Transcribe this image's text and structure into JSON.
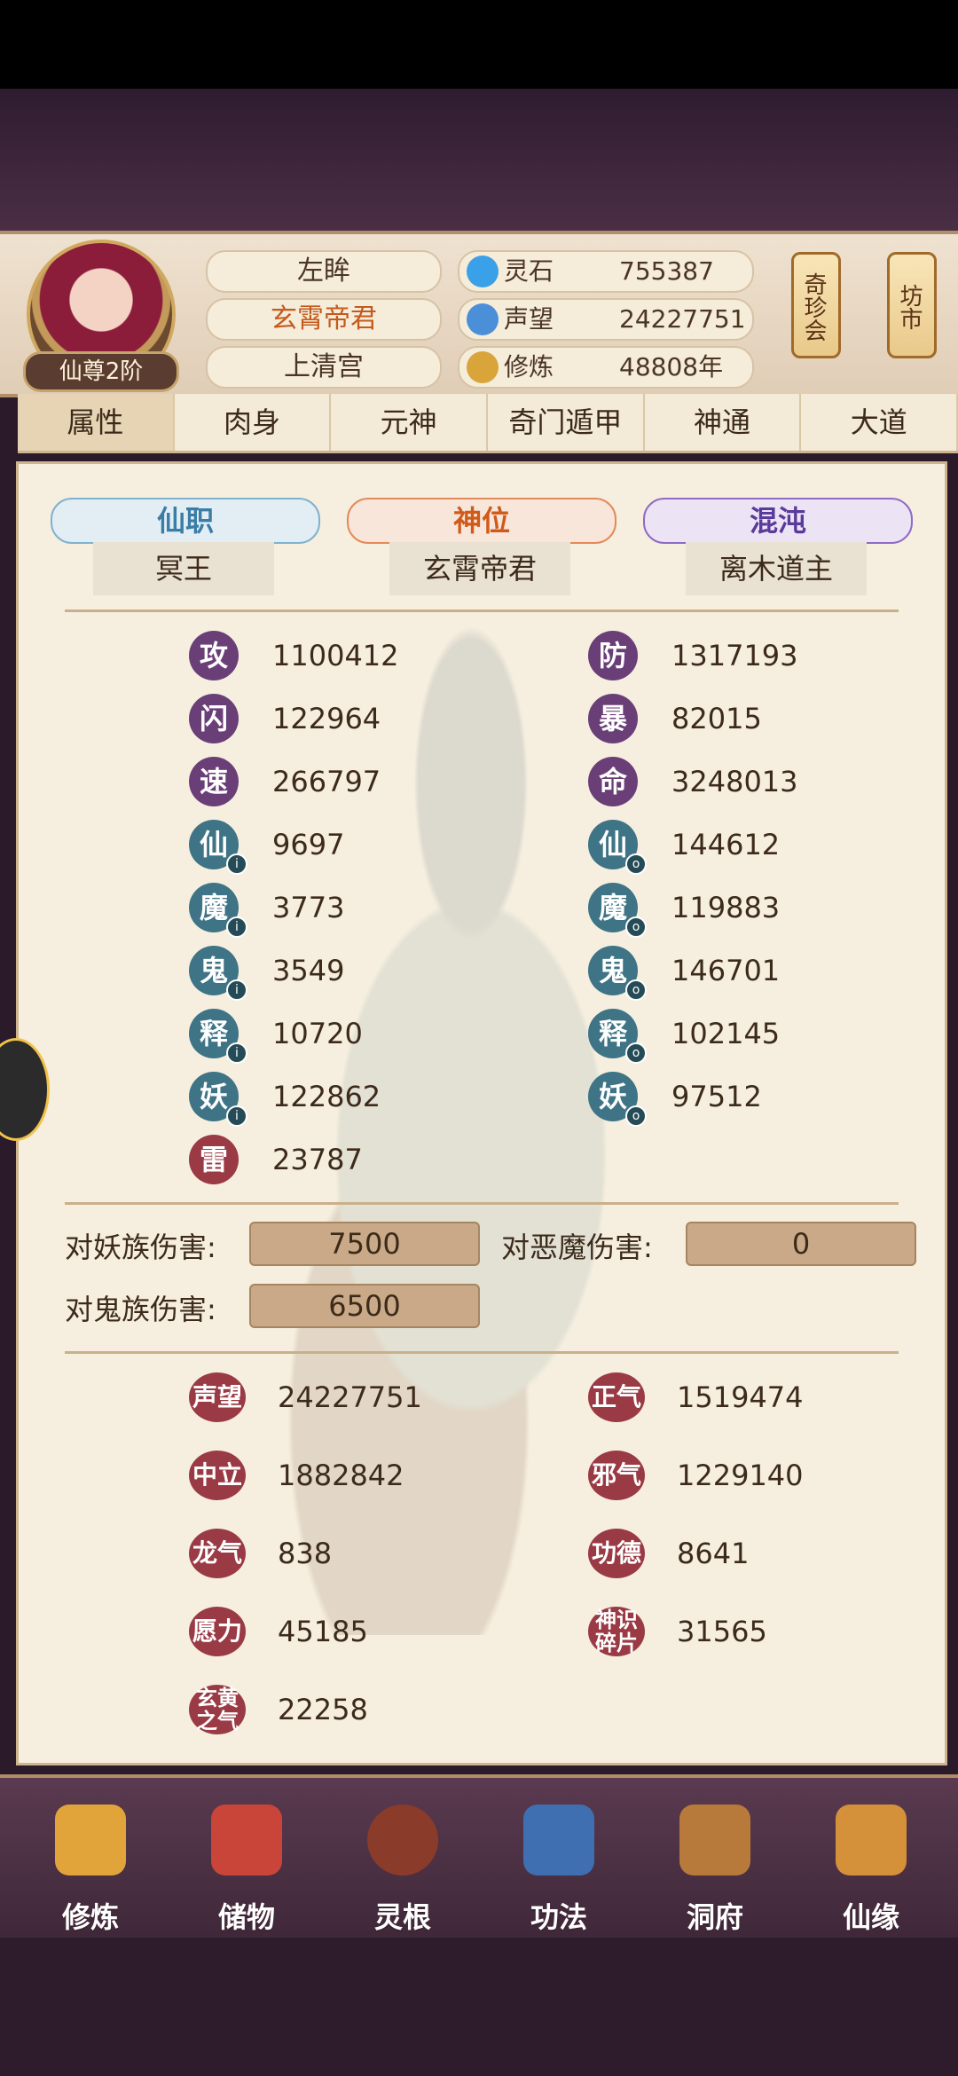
{
  "header": {
    "rank": "仙尊2阶",
    "names": [
      "左眸",
      "玄霄帝君",
      "上清宫"
    ],
    "resources": [
      {
        "label": "灵石",
        "value": "755387",
        "icon": "spirit-stone-icon"
      },
      {
        "label": "声望",
        "value": "24227751",
        "icon": "reputation-drop-icon"
      },
      {
        "label": "修炼",
        "value": "48808年",
        "icon": "meditation-icon"
      }
    ],
    "buttons": {
      "treasure_meet": "奇珍会",
      "market": "坊市"
    }
  },
  "tabs": [
    "属性",
    "肉身",
    "元神",
    "奇门遁甲",
    "神通",
    "大道"
  ],
  "roles": [
    {
      "title": "仙职",
      "value": "冥王"
    },
    {
      "title": "神位",
      "value": "玄霄帝君"
    },
    {
      "title": "混沌",
      "value": "离木道主"
    }
  ],
  "stats_left": [
    {
      "label": "攻",
      "value": "1100412"
    },
    {
      "label": "闪",
      "value": "122964"
    },
    {
      "label": "速",
      "value": "266797"
    },
    {
      "label": "仙",
      "value": "9697"
    },
    {
      "label": "魔",
      "value": "3773"
    },
    {
      "label": "鬼",
      "value": "3549"
    },
    {
      "label": "释",
      "value": "10720"
    },
    {
      "label": "妖",
      "value": "122862"
    },
    {
      "label": "雷",
      "value": "23787"
    }
  ],
  "stats_right": [
    {
      "label": "防",
      "value": "1317193"
    },
    {
      "label": "暴",
      "value": "82015"
    },
    {
      "label": "命",
      "value": "3248013"
    },
    {
      "label": "仙",
      "value": "144612"
    },
    {
      "label": "魔",
      "value": "119883"
    },
    {
      "label": "鬼",
      "value": "146701"
    },
    {
      "label": "释",
      "value": "102145"
    },
    {
      "label": "妖",
      "value": "97512"
    }
  ],
  "damage": [
    {
      "label": "对妖族伤害:",
      "value": "7500"
    },
    {
      "label": "对恶魔伤害:",
      "value": "0"
    },
    {
      "label": "对鬼族伤害:",
      "value": "6500"
    }
  ],
  "extra_left": [
    {
      "label": "声望",
      "value": "24227751"
    },
    {
      "label": "中立",
      "value": "1882842"
    },
    {
      "label": "龙气",
      "value": "838"
    },
    {
      "label": "愿力",
      "value": "45185"
    },
    {
      "label": "玄黄之气",
      "value": "22258"
    }
  ],
  "extra_right": [
    {
      "label": "正气",
      "value": "1519474"
    },
    {
      "label": "邪气",
      "value": "1229140"
    },
    {
      "label": "功德",
      "value": "8641"
    },
    {
      "label": "神识碎片",
      "value": "31565"
    }
  ],
  "nav": [
    {
      "label": "修炼",
      "color": "#e0a43a"
    },
    {
      "label": "储物",
      "color": "#c9453a"
    },
    {
      "label": "灵根",
      "color": "#8a3b2a"
    },
    {
      "label": "功法",
      "color": "#3f6fb0"
    },
    {
      "label": "洞府",
      "color": "#b87a3a"
    },
    {
      "label": "仙缘",
      "color": "#d4913a"
    }
  ]
}
